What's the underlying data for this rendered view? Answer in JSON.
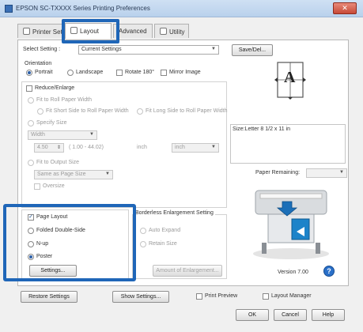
{
  "window": {
    "title": "EPSON SC-TXXXX Series Printing Preferences",
    "close_symbol": "✕"
  },
  "tabs": [
    {
      "label": "Printer Sett..."
    },
    {
      "label": "Layout"
    },
    {
      "label": "Advanced"
    },
    {
      "label": "Utility"
    }
  ],
  "select_setting": {
    "label": "Select Setting :",
    "value": "Current Settings",
    "save_button": "Save/Del..."
  },
  "orientation": {
    "heading": "Orientation",
    "portrait": "Portrait",
    "landscape": "Landscape",
    "rotate": "Rotate 180°",
    "mirror": "Mirror Image"
  },
  "reduce_enlarge": {
    "label": "Reduce/Enlarge",
    "fit_roll_width": "Fit to Roll Paper Width",
    "fit_short_side": "Fit Short Side to Roll Paper Width",
    "fit_long_side": "Fit Long Side to Roll Paper Width",
    "specify_size": "Specify Size",
    "specify_size_value": "Width",
    "size_number": "4.50",
    "size_range": "( 1.00 - 44.02)",
    "size_unit_label": "inch",
    "size_unit_combo": "inch",
    "fit_output": "Fit to Output Size",
    "fit_output_value": "Same as Page Size",
    "oversize": "Oversize"
  },
  "page_layout": {
    "label": "Page Layout",
    "folded": "Folded Double-Side",
    "nup": "N-up",
    "poster": "Poster",
    "settings_button": "Settings..."
  },
  "borderless": {
    "heading": "Borderless Enlargement Setting",
    "auto_expand": "Auto Expand",
    "retain_size": "Retain Size",
    "amount_button": "Amount of Enlargement..."
  },
  "right_panel": {
    "preview_letter": "A",
    "size_info": "Size:Letter 8 1/2 x 11 in",
    "paper_remaining_label": "Paper Remaining:",
    "version": "Version 7.00",
    "help_symbol": "?"
  },
  "bottom": {
    "restore": "Restore Settings",
    "show_settings": "Show Settings...",
    "print_preview": "Print Preview",
    "layout_manager": "Layout Manager",
    "ok": "OK",
    "cancel": "Cancel",
    "help": "Help"
  },
  "colors": {
    "highlight": "#1f66b8",
    "titlebar": "#c6dbf1"
  }
}
